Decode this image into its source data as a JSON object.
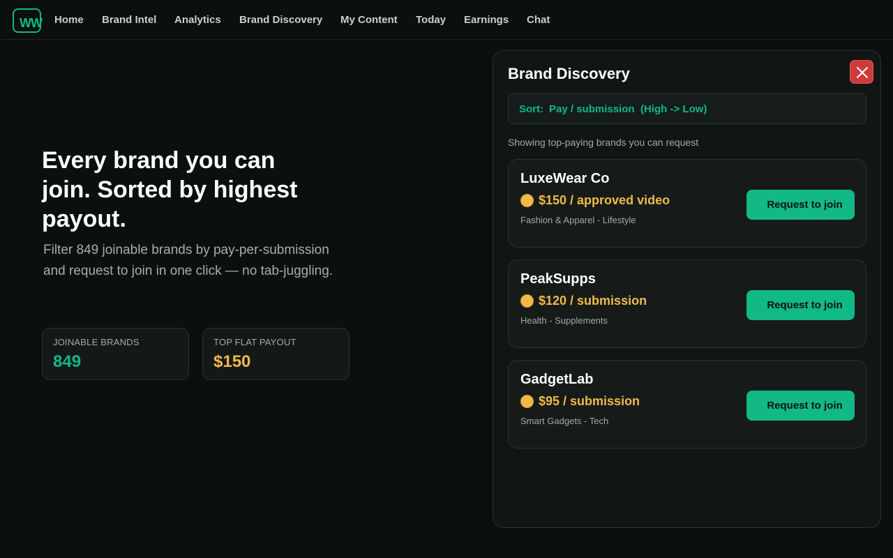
{
  "nav": {
    "logo_text": "WW",
    "items": [
      "Home",
      "Brand Intel",
      "Analytics",
      "Brand Discovery",
      "My Content",
      "Today",
      "Earnings",
      "Chat"
    ]
  },
  "hero": {
    "title": "Every brand you can join. Sorted by highest payout.",
    "subtitle": "Filter 849 joinable brands by pay-per-submission and request to join in one click — no tab-juggling.",
    "stats": [
      {
        "label": "JOINABLE BRANDS",
        "value": "849",
        "color": "#12b886"
      },
      {
        "label": "TOP FLAT PAYOUT",
        "value": "$150",
        "color": "#f0b94a"
      }
    ]
  },
  "panel": {
    "title": "Brand Discovery",
    "close_icon": "close-icon",
    "sort": {
      "prefix": "Sort:",
      "field": "Pay / submission",
      "direction": "(High -> Low)"
    },
    "showing": "Showing top-paying brands you can request",
    "brands": [
      {
        "name": "LuxeWear Co",
        "pay": "$150 / approved video",
        "category": "Fashion & Apparel - Lifestyle",
        "button": "Request to join"
      },
      {
        "name": "PeakSupps",
        "pay": "$120 / submission",
        "category": "Health - Supplements",
        "button": "Request to join"
      },
      {
        "name": "GadgetLab",
        "pay": "$95 / submission",
        "category": "Smart Gadgets - Tech",
        "button": "Request to join"
      }
    ]
  },
  "colors": {
    "accent": "#12b886",
    "payout": "#f0b94a",
    "close": "#cf3b3b",
    "background": "#0b0f0e"
  }
}
